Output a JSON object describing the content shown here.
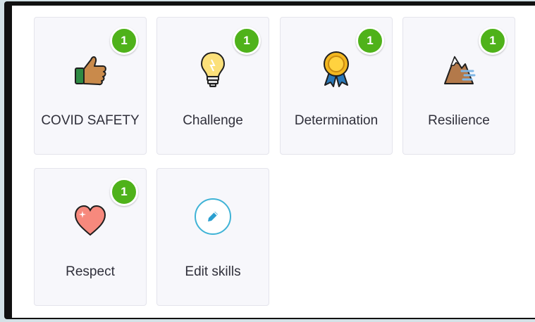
{
  "skills": [
    {
      "label": "COVID SAFETY",
      "count": "1",
      "icon": "thumbs-up-icon"
    },
    {
      "label": "Challenge",
      "count": "1",
      "icon": "lightbulb-icon"
    },
    {
      "label": "Determination",
      "count": "1",
      "icon": "award-medal-icon"
    },
    {
      "label": "Resilience",
      "count": "1",
      "icon": "mountain-icon"
    },
    {
      "label": "Respect",
      "count": "1",
      "icon": "heart-icon"
    }
  ],
  "edit": {
    "label": "Edit skills",
    "icon": "pencil-icon"
  },
  "colors": {
    "badge": "#4fb21a",
    "edit_accent": "#3fb3d6",
    "card_bg": "#f7f7fb"
  }
}
